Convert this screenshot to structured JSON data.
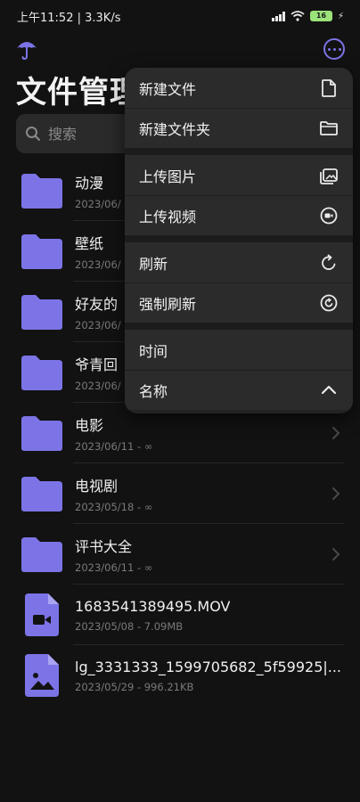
{
  "status_bar": {
    "time": "上午11:52",
    "network_speed": "3.3K/s",
    "battery": "16"
  },
  "header": {
    "title": "文件管理",
    "logo_icon": "umbrella-icon",
    "more_icon": "more-horizontal-icon"
  },
  "search": {
    "placeholder": "搜索"
  },
  "files": [
    {
      "name": "动漫",
      "sub": "2023/06/",
      "type": "folder"
    },
    {
      "name": "壁纸",
      "sub": "2023/06/",
      "type": "folder"
    },
    {
      "name": "好友的",
      "sub": "2023/06/",
      "type": "folder"
    },
    {
      "name": "爷青回",
      "sub": "2023/06/",
      "type": "folder"
    },
    {
      "name": "电影",
      "sub": "2023/06/11 - ∞",
      "type": "folder"
    },
    {
      "name": "电视剧",
      "sub": "2023/05/18 - ∞",
      "type": "folder"
    },
    {
      "name": "评书大全",
      "sub": "2023/06/11 - ∞",
      "type": "folder"
    },
    {
      "name": "1683541389495.MOV",
      "sub": "2023/05/08 - 7.09MB",
      "type": "video"
    },
    {
      "name": "lg_3331333_1599705682_5f59925|...",
      "sub": "2023/05/29 - 996.21KB",
      "type": "image"
    }
  ],
  "menu": {
    "new_file": "新建文件",
    "new_folder": "新建文件夹",
    "upload_image": "上传图片",
    "upload_video": "上传视频",
    "refresh": "刷新",
    "force_refresh": "强制刷新",
    "sort_time": "时间",
    "sort_name": "名称"
  },
  "colors": {
    "accent": "#7c74e6",
    "background": "#121212",
    "menu_bg": "#2b2b2b"
  }
}
